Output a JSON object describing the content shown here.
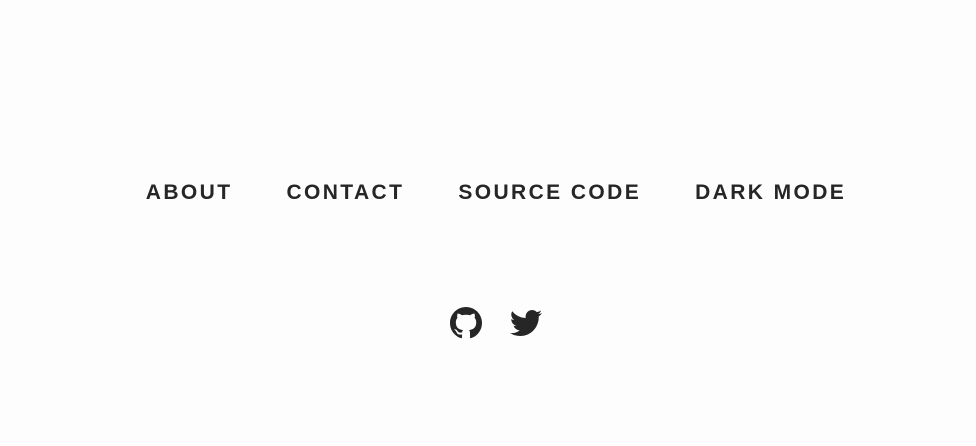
{
  "nav": {
    "items": [
      {
        "label": "ABOUT"
      },
      {
        "label": "CONTACT"
      },
      {
        "label": "SOURCE CODE"
      },
      {
        "label": "DARK MODE"
      }
    ]
  },
  "social": {
    "items": [
      {
        "icon": "github-icon"
      },
      {
        "icon": "twitter-icon"
      }
    ]
  },
  "colors": {
    "background": "#fdfdfd",
    "text": "#262626"
  }
}
